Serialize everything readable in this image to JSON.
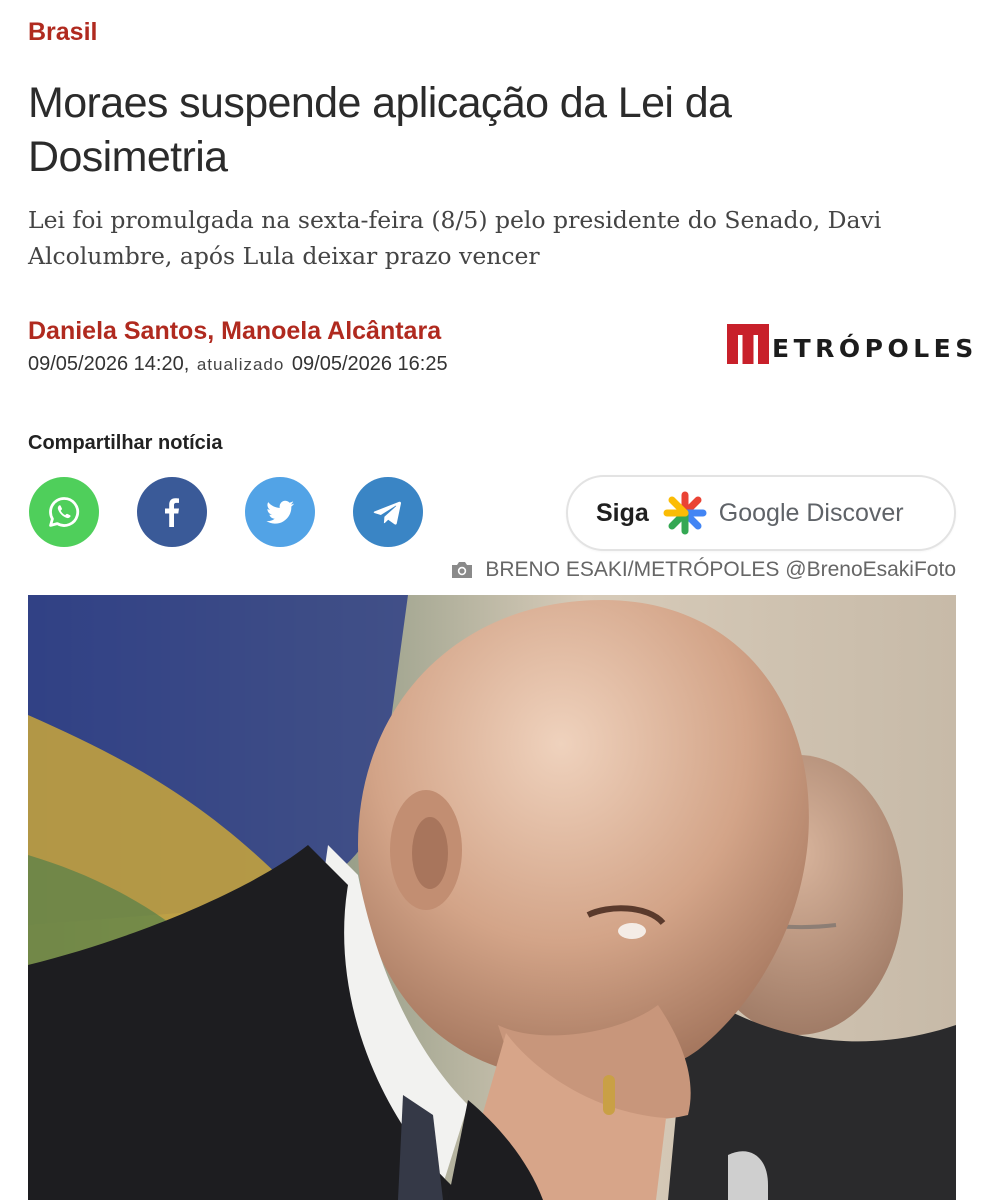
{
  "article": {
    "section": "Brasil",
    "title": "Moraes suspende aplicação da Lei da Dosimetria",
    "subtitle": "Lei foi promulgada na sexta-feira (8/5) pelo presidente do Senado, Davi Alcolumbre, após Lula deixar prazo vencer",
    "authors": "Daniela Santos, Manoela Alcântara",
    "published": "09/05/2026 14:20,",
    "updated_label": "atualizado",
    "updated": "09/05/2026 16:25"
  },
  "brand": {
    "logo_text": "ETRÓPOLES",
    "logo_letter": "M",
    "accent_color": "#b02a1f"
  },
  "share": {
    "label": "Compartilhar notícia",
    "buttons": [
      {
        "network": "WhatsApp",
        "icon": "whatsapp-icon",
        "color": "#4fcf5b"
      },
      {
        "network": "Facebook",
        "icon": "facebook-icon",
        "color": "#3a5a98"
      },
      {
        "network": "Twitter",
        "icon": "twitter-icon",
        "color": "#52a3e6"
      },
      {
        "network": "Telegram",
        "icon": "telegram-icon",
        "color": "#3a85c5"
      }
    ]
  },
  "discover": {
    "follow_label": "Siga",
    "service": "Google Discover",
    "icon": "google-discover-icon"
  },
  "photo": {
    "credit": "BRENO ESAKI/METRÓPOLES @BrenoEsakiFoto",
    "credit_icon": "camera-icon"
  }
}
